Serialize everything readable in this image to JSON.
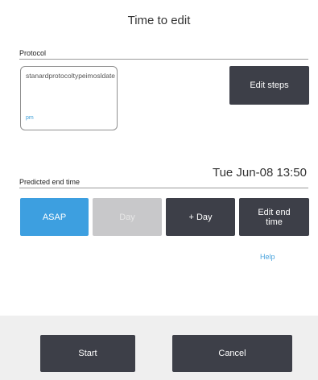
{
  "dialog": {
    "title": "Time to edit"
  },
  "protocol": {
    "section_label": "Protocol",
    "name": "stanardprotocoltypeimosldate",
    "abbreviation": "pm",
    "edit_steps_label": "Edit steps"
  },
  "end_time": {
    "section_label": "Predicted end time",
    "value": "Tue Jun-08 13:50",
    "buttons": {
      "asap": "ASAP",
      "day": "Day",
      "plus_day": "+ Day",
      "edit_end_time": "Edit end time"
    },
    "help_label": "Help"
  },
  "footer": {
    "start_label": "Start",
    "cancel_label": "Cancel"
  },
  "colors": {
    "accent_blue": "#3d9fe0",
    "dark_button": "#3d3f48",
    "disabled_button": "#c8c8ca",
    "link": "#4aa3dd"
  }
}
